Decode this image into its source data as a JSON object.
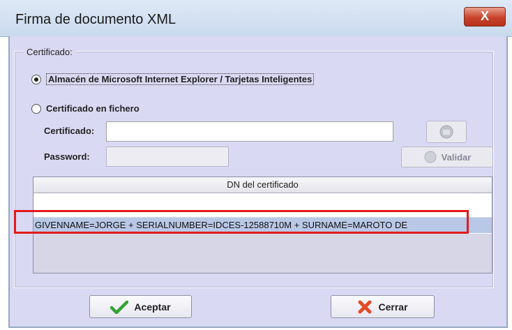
{
  "window": {
    "title": "Firma de documento XML",
    "close_glyph": "X"
  },
  "certificado_group": {
    "legend": "Certificado:"
  },
  "options": {
    "store_label": "Almacén de Microsoft Internet Explorer / Tarjetas Inteligentes",
    "file_label": "Certificado en fichero",
    "selected": "store"
  },
  "file": {
    "cert_label": "Certificado:",
    "cert_value": "",
    "password_label": "Password:",
    "password_value": "",
    "browse_icon": "folder-icon",
    "validate_label": "Validar"
  },
  "table": {
    "header": "DN del certificado",
    "rows": [
      "",
      "GIVENNAME=JORGE + SERIALNUMBER=IDCES-12588710M + SURNAME=MAROTO DE"
    ],
    "selected_row": 1
  },
  "buttons": {
    "accept": "Aceptar",
    "cancel": "Cerrar"
  },
  "colors": {
    "highlight": "#e21b1b",
    "panel": "#d9d9f3"
  }
}
